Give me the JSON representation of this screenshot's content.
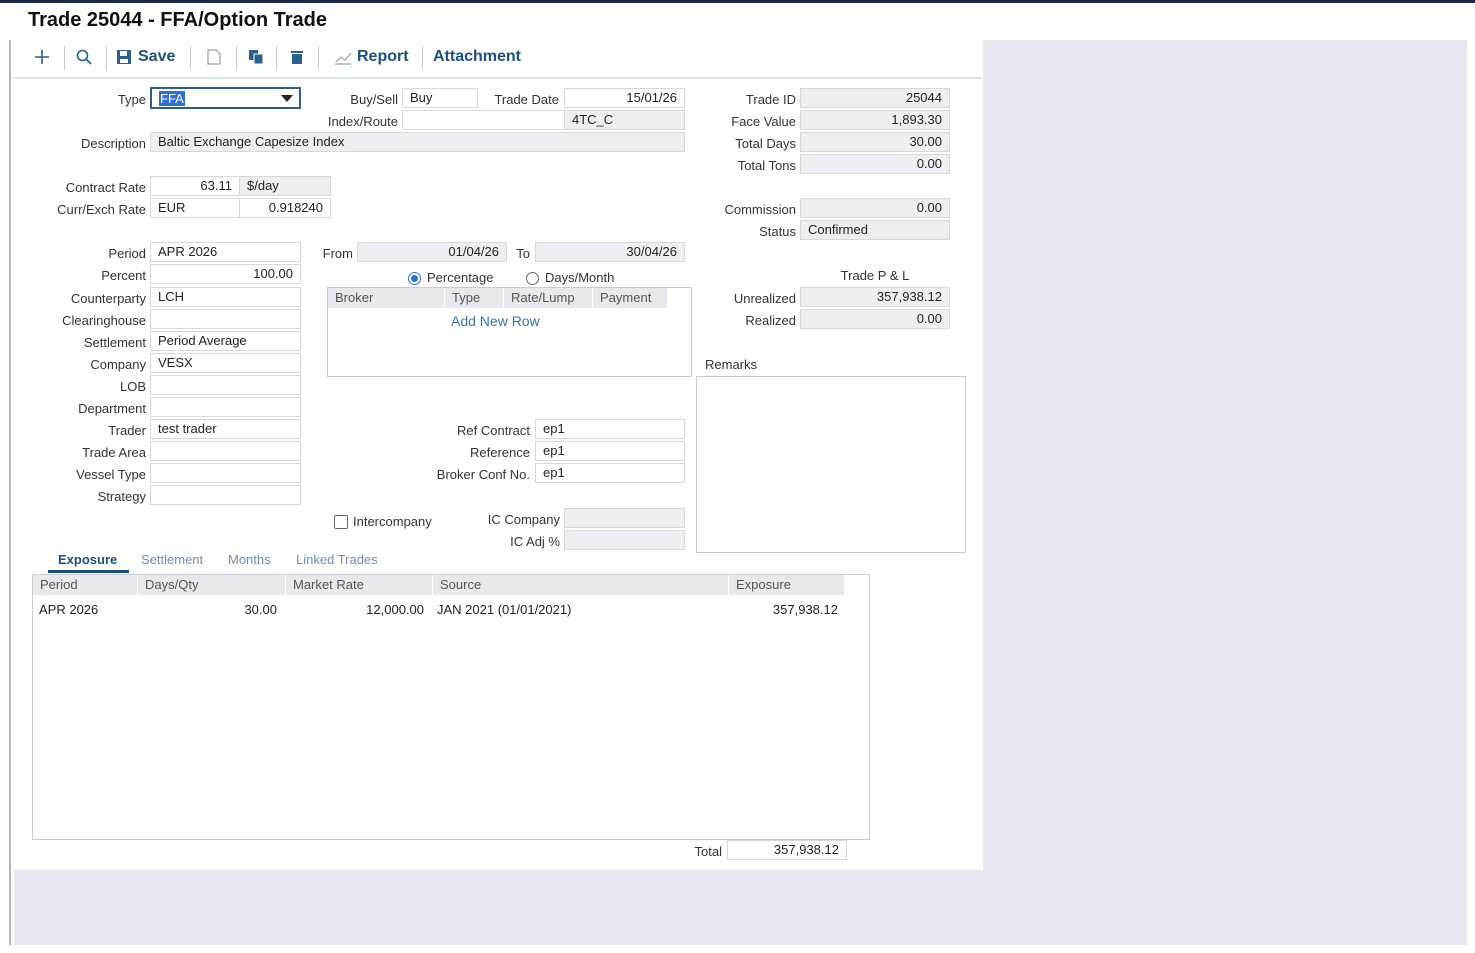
{
  "window": {
    "title": "Trade 25044 - FFA/Option Trade"
  },
  "toolbar": {
    "save": "Save",
    "report": "Report",
    "attachment": "Attachment"
  },
  "fields": {
    "type": {
      "label": "Type",
      "value": "FFA"
    },
    "buysell": {
      "label": "Buy/Sell",
      "value": "Buy"
    },
    "tradedate": {
      "label": "Trade Date",
      "value": "15/01/26"
    },
    "indexroute": {
      "label": "Index/Route",
      "value": "",
      "value2": "4TC_C"
    },
    "description": {
      "label": "Description",
      "value": "Baltic Exchange Capesize Index"
    },
    "contractrate": {
      "label": "Contract Rate",
      "value": "63.11",
      "unit": "$/day"
    },
    "currexch": {
      "label": "Curr/Exch Rate",
      "value": "EUR",
      "rate": "0.918240"
    },
    "period": {
      "label": "Period",
      "value": "APR 2026"
    },
    "percent": {
      "label": "Percent",
      "value": "100.00"
    },
    "counterparty": {
      "label": "Counterparty",
      "value": "LCH"
    },
    "clearinghouse": {
      "label": "Clearinghouse",
      "value": ""
    },
    "settlement": {
      "label": "Settlement",
      "value": "Period Average"
    },
    "company": {
      "label": "Company",
      "value": "VESX"
    },
    "lob": {
      "label": "LOB",
      "value": ""
    },
    "department": {
      "label": "Department",
      "value": ""
    },
    "trader": {
      "label": "Trader",
      "value": "test trader"
    },
    "tradearea": {
      "label": "Trade Area",
      "value": ""
    },
    "vesseltype": {
      "label": "Vessel Type",
      "value": ""
    },
    "strategy": {
      "label": "Strategy",
      "value": ""
    },
    "from": {
      "label": "From",
      "value": "01/04/26"
    },
    "to": {
      "label": "To",
      "value": "30/04/26"
    },
    "refcontract": {
      "label": "Ref Contract",
      "value": "ep1"
    },
    "reference": {
      "label": "Reference",
      "value": "ep1"
    },
    "brokerconf": {
      "label": "Broker Conf No.",
      "value": "ep1"
    },
    "intercompany": {
      "label": "Intercompany"
    },
    "iccompany": {
      "label": "IC Company",
      "value": ""
    },
    "icadj": {
      "label": "IC Adj %",
      "value": ""
    }
  },
  "radios": {
    "percentage": "Percentage",
    "daysmonth": "Days/Month"
  },
  "broker_grid": {
    "headers": [
      "Broker",
      "Type",
      "Rate/Lump",
      "Payment"
    ],
    "add_row": "Add New Row"
  },
  "summary": {
    "tradeid": {
      "label": "Trade ID",
      "value": "25044"
    },
    "facevalue": {
      "label": "Face Value",
      "value": "1,893.30"
    },
    "totaldays": {
      "label": "Total Days",
      "value": "30.00"
    },
    "totaltons": {
      "label": "Total Tons",
      "value": "0.00"
    },
    "commission": {
      "label": "Commission",
      "value": "0.00"
    },
    "status": {
      "label": "Status",
      "value": "Confirmed"
    },
    "pnl_title": "Trade P & L",
    "unrealized": {
      "label": "Unrealized",
      "value": "357,938.12"
    },
    "realized": {
      "label": "Realized",
      "value": "0.00"
    },
    "remarks_label": "Remarks"
  },
  "tabs": [
    "Exposure",
    "Settlement",
    "Months",
    "Linked Trades"
  ],
  "exposure": {
    "headers": [
      "Period",
      "Days/Qty",
      "Market Rate",
      "Source",
      "Exposure"
    ],
    "rows": [
      [
        "APR 2026",
        "30.00",
        "12,000.00",
        "JAN 2021 (01/01/2021)",
        "357,938.12"
      ]
    ],
    "total_label": "Total",
    "total_value": "357,938.12"
  }
}
